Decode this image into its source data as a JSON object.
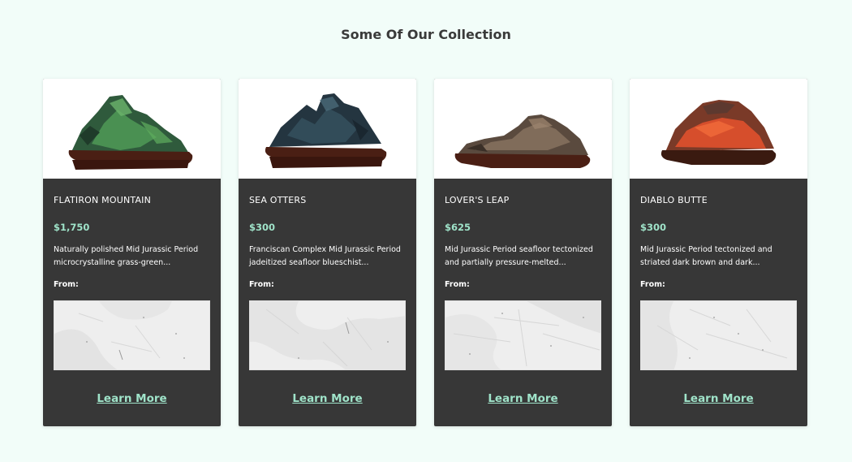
{
  "section": {
    "title": "Some Of Our Collection"
  },
  "colors": {
    "background": "#f2fdf9",
    "card": "#373737",
    "accent": "#9fe3c9"
  },
  "cards": [
    {
      "name": "FLATIRON MOUNTAIN",
      "price": "$1,750",
      "description": "Naturally polished Mid Jurassic Period microcrystalline grass-green...",
      "from_label": "From:",
      "cta": "Learn More",
      "stone_color": "#3c6b48"
    },
    {
      "name": "SEA OTTERS",
      "price": "$300",
      "description": "Franciscan Complex Mid Jurassic Period jadeitized seafloor blueschist...",
      "from_label": "From:",
      "cta": "Learn More",
      "stone_color": "#2b3a44"
    },
    {
      "name": "LOVER'S LEAP",
      "price": "$625",
      "description": "Mid Jurassic Period seafloor tectonized and partially pressure-melted...",
      "from_label": "From:",
      "cta": "Learn More",
      "stone_color": "#6e5a4b"
    },
    {
      "name": "DIABLO BUTTE",
      "price": "$300",
      "description": "Mid Jurassic Period tectonized and striated dark brown and dark...",
      "from_label": "From:",
      "cta": "Learn More",
      "stone_color": "#c8482b"
    }
  ]
}
